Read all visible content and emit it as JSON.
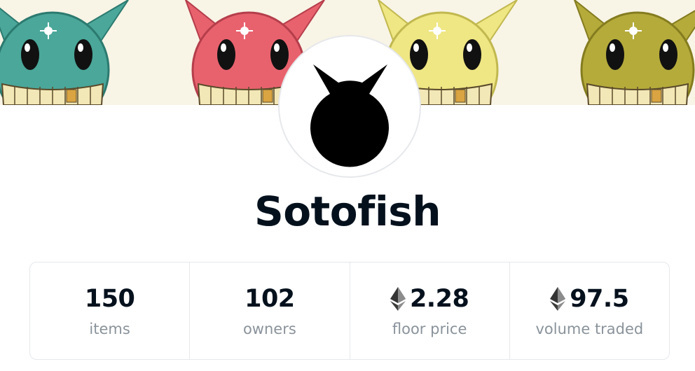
{
  "collection": {
    "name": "Sotofish"
  },
  "banner": {
    "background_color": "#f8f4e6",
    "characters": [
      {
        "color": "#4aa79a",
        "dark": "#2c7a6f"
      },
      {
        "color": "#e8626e",
        "dark": "#b53e4b"
      },
      {
        "color": "#efe684",
        "dark": "#c1b84f"
      },
      {
        "color": "#b5ab3b",
        "dark": "#847c1f"
      }
    ]
  },
  "stats": [
    {
      "value": "150",
      "label": "items",
      "icon": null
    },
    {
      "value": "102",
      "label": "owners",
      "icon": null
    },
    {
      "value": "2.28",
      "label": "floor price",
      "icon": "ethereum-icon"
    },
    {
      "value": "97.5",
      "label": "volume traded",
      "icon": "ethereum-icon"
    }
  ]
}
